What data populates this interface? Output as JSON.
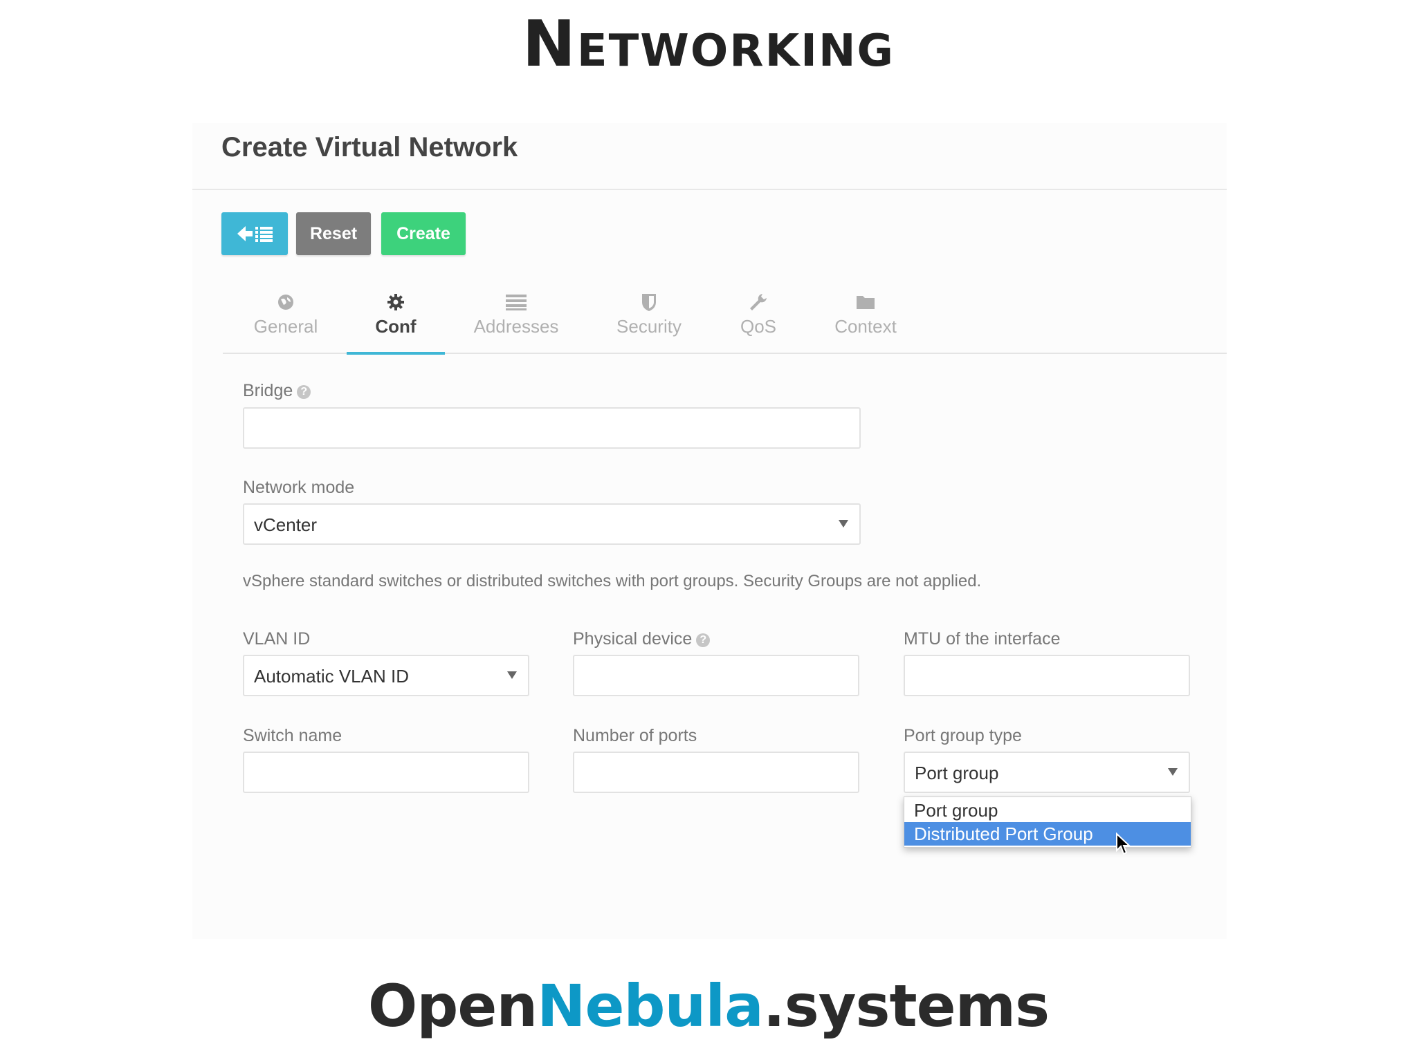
{
  "slide": {
    "title": "Networking"
  },
  "form": {
    "title": "Create Virtual Network",
    "toolbar": {
      "back_icon": "arrow-left-list-icon",
      "reset_label": "Reset",
      "create_label": "Create"
    },
    "tabs": [
      {
        "label": "General",
        "icon": "globe-icon",
        "active": false
      },
      {
        "label": "Conf",
        "icon": "gear-icon",
        "active": true
      },
      {
        "label": "Addresses",
        "icon": "list-icon",
        "active": false
      },
      {
        "label": "Security",
        "icon": "shield-icon",
        "active": false
      },
      {
        "label": "QoS",
        "icon": "wrench-icon",
        "active": false
      },
      {
        "label": "Context",
        "icon": "folder-icon",
        "active": false
      }
    ],
    "bridge": {
      "label": "Bridge",
      "value": ""
    },
    "network_mode": {
      "label": "Network mode",
      "value": "vCenter"
    },
    "help_text": "vSphere standard switches or distributed switches with port groups. Security Groups are not applied.",
    "vlan_id": {
      "label": "VLAN ID",
      "value": "Automatic VLAN ID"
    },
    "physical_device": {
      "label": "Physical device",
      "value": ""
    },
    "mtu": {
      "label": "MTU of the interface",
      "value": ""
    },
    "switch_name": {
      "label": "Switch name",
      "value": ""
    },
    "number_of_ports": {
      "label": "Number of ports",
      "value": ""
    },
    "port_group_type": {
      "label": "Port group type",
      "value": "Port group",
      "options": [
        "Port group",
        "Distributed Port Group"
      ],
      "highlighted": "Distributed Port Group"
    }
  },
  "brand": {
    "part1": "Open",
    "part2": "Nebula",
    "part3": ".systems"
  },
  "colors": {
    "accent": "#3fb7d6",
    "create": "#3dd27c",
    "reset": "#7d7d7d",
    "highlight": "#4d8fe3",
    "brand_accent": "#0d98c6"
  }
}
